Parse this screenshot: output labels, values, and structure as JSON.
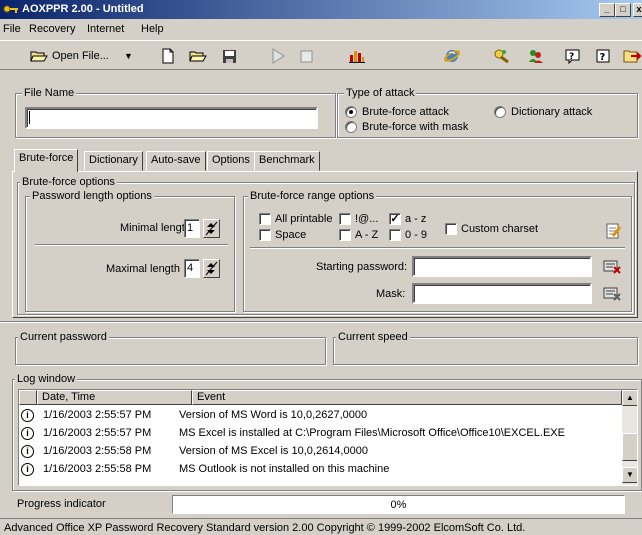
{
  "window": {
    "title": "AOXPPR 2.00 - Untitled",
    "controls": {
      "minimize": "_",
      "maximize": "□",
      "close": "x"
    }
  },
  "menu": [
    "File",
    "Recovery",
    "Internet",
    "Help"
  ],
  "toolbar": {
    "open_label": "Open File...",
    "open_dropdown": "▼",
    "icons": [
      "new-file-icon",
      "open-folder-icon",
      "save-icon",
      "start-icon",
      "stop-icon",
      "benchmark-chart-icon",
      "internet-icon",
      "search-key-icon",
      "users-icon",
      "help-tips-icon",
      "help-icon",
      "exit-icon"
    ]
  },
  "file_name": {
    "label": "File Name",
    "value": ""
  },
  "attack": {
    "label": "Type of attack",
    "options": [
      {
        "label": "Brute-force attack",
        "selected": true
      },
      {
        "label": "Dictionary attack",
        "selected": false
      },
      {
        "label": "Brute-force with mask",
        "selected": false
      }
    ]
  },
  "tabs": [
    "Brute-force",
    "Dictionary",
    "Auto-save",
    "Options",
    "Benchmark"
  ],
  "active_tab": "Brute-force",
  "bruteforce": {
    "group_label": "Brute-force options",
    "length": {
      "label": "Password length options",
      "min_label": "Minimal length",
      "min_value": "1",
      "max_label": "Maximal length",
      "max_value": "4"
    },
    "range": {
      "label": "Brute-force range options",
      "options": [
        {
          "label": "All printable",
          "checked": false
        },
        {
          "label": "!@...",
          "checked": false
        },
        {
          "label": "a - z",
          "checked": true
        },
        {
          "label": "Custom charset",
          "checked": false
        },
        {
          "label": "Space",
          "checked": false
        },
        {
          "label": "A - Z",
          "checked": false
        },
        {
          "label": "0 - 9",
          "checked": false
        }
      ],
      "starting_password_label": "Starting password:",
      "starting_password_value": "",
      "mask_label": "Mask:",
      "mask_value": ""
    }
  },
  "current_password": {
    "label": "Current password",
    "value": ""
  },
  "current_speed": {
    "label": "Current speed",
    "value": ""
  },
  "log": {
    "label": "Log window",
    "columns": [
      "Date, Time",
      "Event"
    ],
    "rows": [
      {
        "time": "1/16/2003 2:55:57 PM",
        "event": "Version of MS Word is 10,0,2627,0000"
      },
      {
        "time": "1/16/2003 2:55:57 PM",
        "event": "MS Excel is installed at C:\\Program Files\\Microsoft Office\\Office10\\EXCEL.EXE"
      },
      {
        "time": "1/16/2003 2:55:58 PM",
        "event": "Version of MS Excel is 10,0,2614,0000"
      },
      {
        "time": "1/16/2003 2:55:58 PM",
        "event": "MS Outlook is not installed on this machine"
      }
    ]
  },
  "progress": {
    "label": "Progress indicator",
    "text": "0%",
    "value": 0
  },
  "status_bar": "Advanced Office XP Password Recovery Standard version 2.00 Copyright © 1999-2002 ElcomSoft Co. Ltd."
}
